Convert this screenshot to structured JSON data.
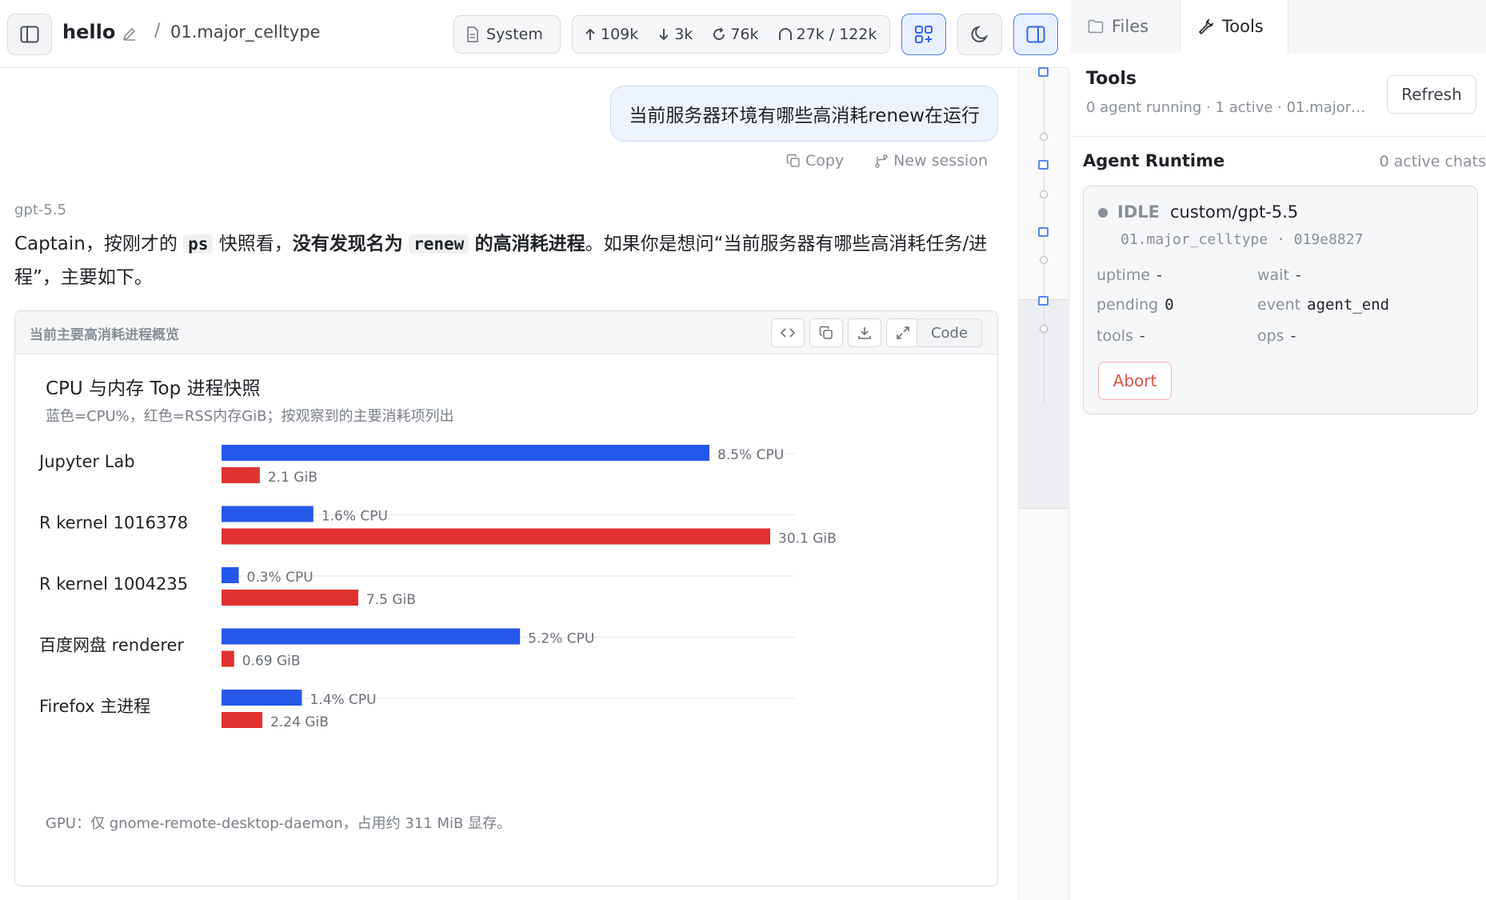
{
  "header": {
    "title": "hello",
    "breadcrumb_sep": "/",
    "breadcrumb": "01.major_celltype",
    "system_label": "System",
    "stats": {
      "up": "109k",
      "down": "3k",
      "cycle": "76k",
      "context": "27k / 122k"
    }
  },
  "chat": {
    "user_message": "当前服务器环境有哪些高消耗renew在运行",
    "actions": {
      "copy": "Copy",
      "new_session": "New session"
    },
    "model": "gpt-5.5",
    "answer": {
      "p1": "Captain，按刚才的",
      "code1": "ps",
      "p2": "快照看，",
      "b1": "没有发现名为",
      "code2": "renew",
      "b2": "的高消耗进程",
      "p3": "。如果你是想问“当前服务器有哪些高消耗任务/进程”，主要如下。"
    },
    "card": {
      "title": "当前主要高消耗进程概览",
      "code_label": "Code"
    }
  },
  "chart_data": {
    "type": "bar",
    "title": "CPU 与内存 Top 进程快照",
    "subtitle": "蓝色=CPU%，红色=RSS内存GiB；按观察到的主要消耗项列出",
    "categories": [
      "Jupyter Lab",
      "R kernel 1016378",
      "R kernel 1004235",
      "百度网盘 renderer",
      "Firefox 主进程"
    ],
    "series": [
      {
        "name": "CPU%",
        "color": "#2557e8",
        "values": [
          8.5,
          1.6,
          0.3,
          5.2,
          1.4
        ],
        "labels": [
          "8.5% CPU",
          "1.6% CPU",
          "0.3% CPU",
          "5.2% CPU",
          "1.4% CPU"
        ]
      },
      {
        "name": "RSS内存GiB",
        "color": "#e03131",
        "values": [
          2.1,
          30.1,
          7.5,
          0.69,
          2.24
        ],
        "labels": [
          "2.1 GiB",
          "30.1 GiB",
          "7.5 GiB",
          "0.69 GiB",
          "2.24 GiB"
        ]
      }
    ],
    "footnote": "GPU：仅 gnome-remote-desktop-daemon，占用约 311 MiB 显存。"
  },
  "right_panel": {
    "tabs": [
      "Files",
      "Tools"
    ],
    "active_tab": "Tools",
    "tools_title": "Tools",
    "tools_sub": "0 agent running · 1 active · 01.major_...",
    "refresh": "Refresh",
    "runtime_title": "Agent Runtime",
    "runtime_count": "0 active chats",
    "agent": {
      "status": "IDLE",
      "model": "custom/gpt-5.5",
      "ids": "01.major_celltype · 019e8827",
      "uptime_k": "uptime",
      "uptime_v": "-",
      "wait_k": "wait",
      "wait_v": "-",
      "pending_k": "pending",
      "pending_v": "0",
      "event_k": "event",
      "event_v": "agent_end",
      "tools_k": "tools",
      "tools_v": "-",
      "ops_k": "ops",
      "ops_v": "-",
      "abort": "Abort"
    }
  }
}
